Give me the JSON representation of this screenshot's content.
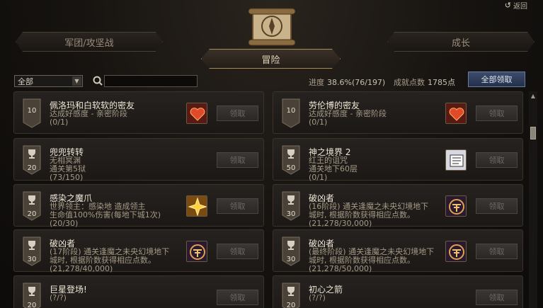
{
  "header": {
    "return_label": "返回",
    "return_icon": "return-arrow-icon"
  },
  "tabs": {
    "left": "军团/攻坚战",
    "center": "冒险",
    "right": "成长"
  },
  "filter": {
    "selected": "全部",
    "search_placeholder": "",
    "search_value": ""
  },
  "stats": {
    "progress_label": "进度",
    "progress_value": "38.6%(76/197)",
    "points_label": "成就点数",
    "points_value": "1785点",
    "claim_all_label": "全部领取"
  },
  "achievements": [
    {
      "badge_type": "level",
      "badge": "10",
      "title": "佩洛玛和白软软的密友",
      "desc": [
        "达成好感度 - 亲密阶段"
      ],
      "count": "(0/1)",
      "reward_icon": "heart-icon",
      "claim_label": "领取"
    },
    {
      "badge_type": "level",
      "badge": "10",
      "title": "劳伦博的密友",
      "desc": [
        "达成好感度 - 亲密阶段"
      ],
      "count": "(0/1)",
      "reward_icon": "heart-icon",
      "claim_label": "领取"
    },
    {
      "badge_type": "trophy",
      "badge": "20",
      "title": "兜兜转转",
      "desc": [
        "无相冥渊",
        "通关第5狱"
      ],
      "count": "(73/150)",
      "reward_icon": "",
      "claim_label": "领取"
    },
    {
      "badge_type": "trophy",
      "badge": "50",
      "title": "神之境界 2",
      "desc": [
        "红王的诅咒",
        "通关地下60层"
      ],
      "count": "(0/1)",
      "reward_icon": "scroll-icon",
      "claim_label": "领取"
    },
    {
      "badge_type": "trophy",
      "badge": "20",
      "title": "感染之魔爪",
      "desc": [
        "世界领主：感染地        造成领主",
        "生命值100%伤害(每地下城1次)"
      ],
      "count": "(20/30)",
      "reward_icon": "star-icon",
      "claim_label": "领取"
    },
    {
      "badge_type": "trophy",
      "badge": "30",
      "title": "破凶者",
      "desc": [
        "(16阶段) 通关逢魔之未央幻境地下",
        "城时, 根据阶数获得相应点数。"
      ],
      "count": "(21,278/30,000)",
      "reward_icon": "emblem-icon",
      "claim_label": "领取"
    },
    {
      "badge_type": "trophy",
      "badge": "30",
      "title": "破凶者",
      "desc": [
        "(17阶段) 通关逢魔之未央幻境地下",
        "城时, 根据阶数获得相应点数。"
      ],
      "count": "(21,278/40,000)",
      "reward_icon": "emblem-icon",
      "claim_label": "领取"
    },
    {
      "badge_type": "trophy",
      "badge": "30",
      "title": "破凶者",
      "desc": [
        "(最终阶段) 通关逢魔之未央幻境地下",
        "城时, 根据阶数获得相应点数。"
      ],
      "count": "(21,278/50,000)",
      "reward_icon": "emblem-icon",
      "claim_label": "领取"
    },
    {
      "badge_type": "trophy",
      "badge": "20",
      "title": "巨星登场!",
      "desc": [],
      "count": "(?/?)",
      "reward_icon": "",
      "claim_label": "领取"
    },
    {
      "badge_type": "trophy",
      "badge": "20",
      "title": "初心之箭",
      "desc": [],
      "count": "(?/?)",
      "reward_icon": "",
      "claim_label": "领取"
    }
  ],
  "colors": {
    "accent_gold": "#a88a5a",
    "claim_all_blue": "#24304a",
    "badge_dark": "#4a4238"
  }
}
